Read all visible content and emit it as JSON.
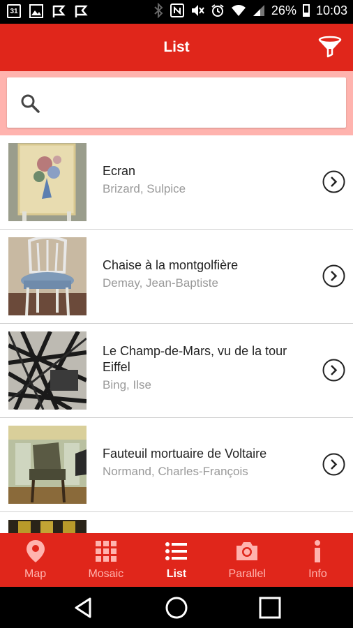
{
  "status_bar": {
    "calendar_day": "31",
    "battery": "26%",
    "time": "10:03",
    "icons": [
      "calendar-icon",
      "image-icon",
      "flag-icon",
      "flag-icon",
      "bluetooth-icon",
      "nfc-icon",
      "mute-icon",
      "alarm-icon",
      "wifi-icon",
      "signal-icon",
      "battery-icon"
    ]
  },
  "app_bar": {
    "title": "List",
    "filter_icon": "filter-icon"
  },
  "search": {
    "placeholder": "",
    "value": ""
  },
  "items": [
    {
      "title": "Ecran",
      "subtitle": "Brizard, Sulpice"
    },
    {
      "title": "Chaise à la montgolfière",
      "subtitle": "Demay, Jean-Baptiste"
    },
    {
      "title": "Le Champ-de-Mars, vu de la tour Eiffel",
      "subtitle": "Bing, Ilse"
    },
    {
      "title": "Fauteuil mortuaire de Voltaire",
      "subtitle": "Normand, Charles-François"
    }
  ],
  "bottom_nav": [
    {
      "label": "Map",
      "icon": "map-pin-icon",
      "active": false
    },
    {
      "label": "Mosaic",
      "icon": "grid-icon",
      "active": false
    },
    {
      "label": "List",
      "icon": "list-icon",
      "active": true
    },
    {
      "label": "Parallel",
      "icon": "camera-icon",
      "active": false
    },
    {
      "label": "Info",
      "icon": "info-icon",
      "active": false
    }
  ],
  "colors": {
    "primary": "#e0261b",
    "search_strip": "#ffb3ae",
    "inactive_nav": "#ffb3ae",
    "subtitle": "#999999"
  }
}
